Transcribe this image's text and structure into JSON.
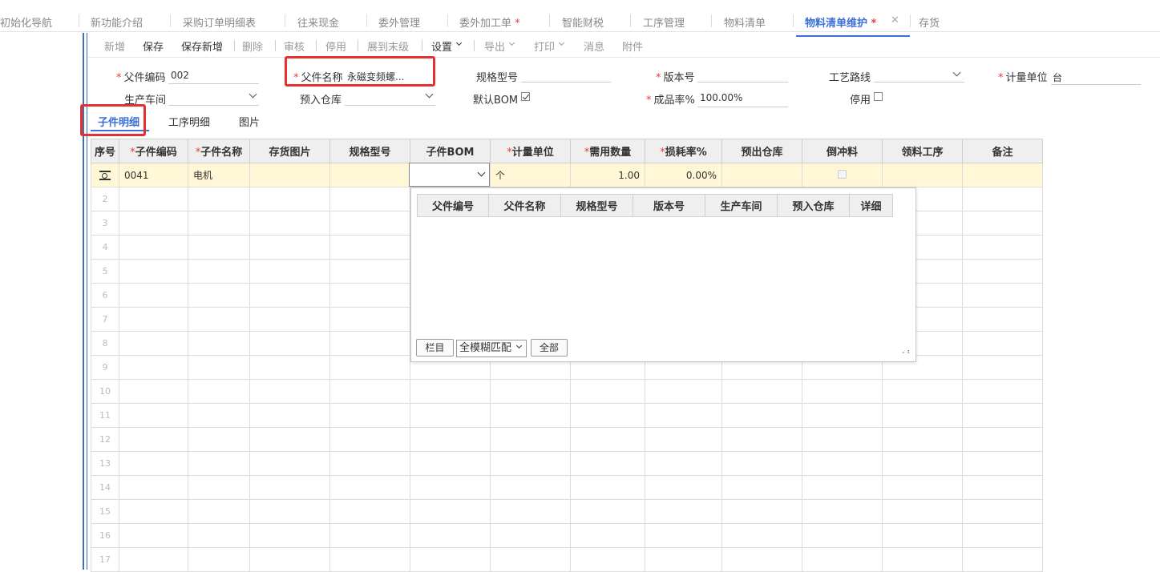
{
  "tabs": [
    {
      "label": "初始化导航",
      "star": false
    },
    {
      "label": "新功能介绍",
      "star": false
    },
    {
      "label": "采购订单明细表",
      "star": false
    },
    {
      "label": "往来现金",
      "star": false
    },
    {
      "label": "委外管理",
      "star": false
    },
    {
      "label": "委外加工单",
      "star": true
    },
    {
      "label": "智能财税",
      "star": false
    },
    {
      "label": "工序管理",
      "star": false
    },
    {
      "label": "物料清单",
      "star": false
    },
    {
      "label": "物料清单维护",
      "star": true
    },
    {
      "label": "存货",
      "star": false
    }
  ],
  "star_mark": "*",
  "close_mark": "✕",
  "toolbar": {
    "new": "新增",
    "save": "保存",
    "save_new": "保存新增",
    "delete": "删除",
    "audit": "审核",
    "disable": "停用",
    "expand": "展到末级",
    "settings": "设置",
    "export": "导出",
    "print": "打印",
    "message": "消息",
    "attachment": "附件"
  },
  "form": {
    "parent_code_label": "父件编码",
    "parent_code": "002",
    "parent_name_label": "父件名称",
    "parent_name": "永磁变频螺...",
    "spec_label": "规格型号",
    "spec": "",
    "version_label": "版本号",
    "version": "",
    "route_label": "工艺路线",
    "route": "",
    "unit_label": "计量单位",
    "unit": "台",
    "workshop_label": "生产车间",
    "workshop": "",
    "warehouse_label": "预入仓库",
    "warehouse": "",
    "default_bom_label": "默认BOM",
    "default_bom": true,
    "yield_label": "成品率%",
    "yield": "100.00%",
    "stop_label": "停用",
    "stop": false,
    "req_mark": "*"
  },
  "subtabs": [
    "子件明细",
    "工序明细",
    "图片"
  ],
  "grid": {
    "headers": [
      {
        "label": "序号",
        "req": false
      },
      {
        "label": "子件编码",
        "req": true
      },
      {
        "label": "子件名称",
        "req": true
      },
      {
        "label": "存货图片",
        "req": false
      },
      {
        "label": "规格型号",
        "req": false
      },
      {
        "label": "子件BOM",
        "req": false
      },
      {
        "label": "计量单位",
        "req": true
      },
      {
        "label": "需用数量",
        "req": true
      },
      {
        "label": "损耗率%",
        "req": true
      },
      {
        "label": "预出仓库",
        "req": false
      },
      {
        "label": "倒冲料",
        "req": false
      },
      {
        "label": "领料工序",
        "req": false
      },
      {
        "label": "备注",
        "req": false
      }
    ],
    "row1": {
      "code": "0041",
      "name": "电机",
      "unit": "个",
      "qty": "1.00",
      "loss": "0.00%"
    },
    "row_numbers": [
      "2",
      "3",
      "4",
      "5",
      "6",
      "7",
      "8",
      "9",
      "10",
      "11",
      "12",
      "13",
      "14",
      "15",
      "16",
      "17"
    ]
  },
  "popup": {
    "headers": [
      "父件编号",
      "父件名称",
      "规格型号",
      "版本号",
      "生产车间",
      "预入仓库",
      "详细"
    ],
    "btn_columns": "栏目",
    "match_mode": "全模糊匹配",
    "btn_all": "全部"
  }
}
